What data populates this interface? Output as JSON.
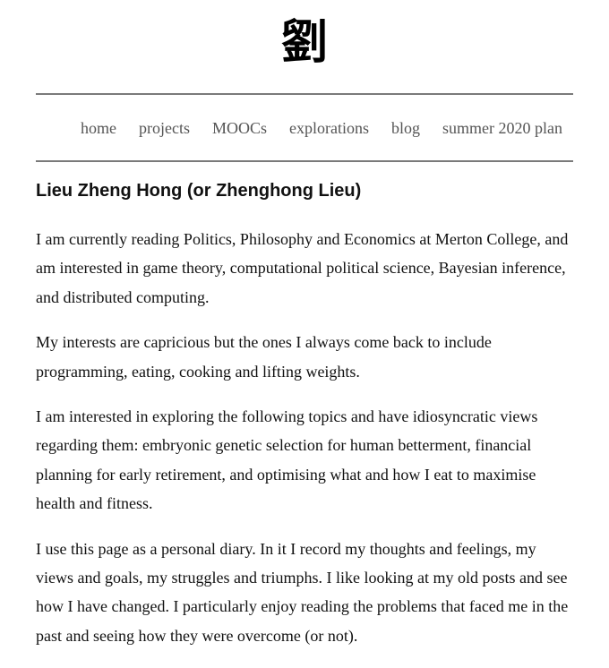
{
  "header": {
    "logo": "劉"
  },
  "nav": {
    "items": [
      {
        "label": "home"
      },
      {
        "label": "projects"
      },
      {
        "label": "MOOCs"
      },
      {
        "label": "explorations"
      },
      {
        "label": "blog"
      },
      {
        "label": "summer 2020 plan"
      }
    ]
  },
  "main": {
    "title": "Lieu Zheng Hong (or Zhenghong Lieu)",
    "paragraphs": [
      "I am currently reading Politics, Philosophy and Economics at Merton College, and am interested in game theory, computational political science, Bayesian inference, and distributed computing.",
      "My interests are capricious but the ones I always come back to include programming, eating, cooking and lifting weights.",
      "I am interested in exploring the following topics and have idiosyncratic views regarding them: embryonic genetic selection for human betterment, financial planning for early retirement, and optimising what and how I eat to maximise health and fitness.",
      "I use this page as a personal diary. In it I record my thoughts and feelings, my views and goals, my struggles and triumphs. I like looking at my old posts and see how I have changed. I particularly enjoy reading the problems that faced me in the past and seeing how they were overcome (or not)."
    ]
  },
  "colors": {
    "text": "#111111",
    "nav_link": "#555555",
    "rule": "#7a7a7a",
    "background": "#ffffff"
  }
}
